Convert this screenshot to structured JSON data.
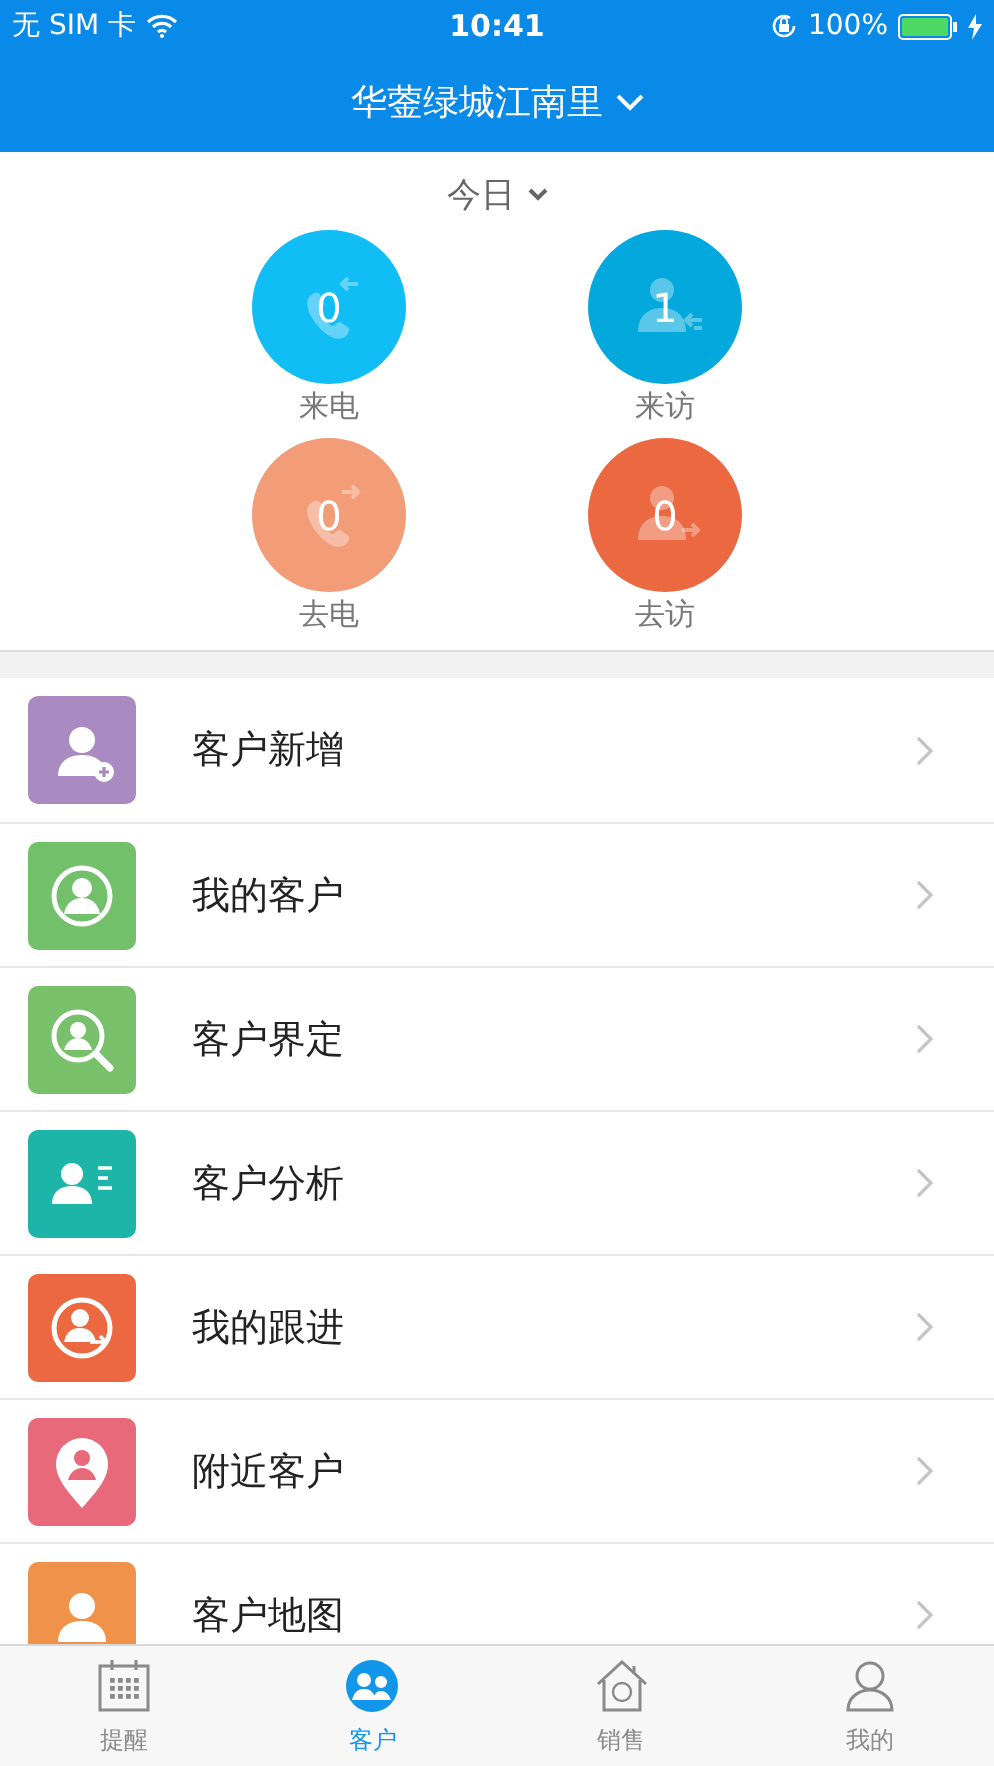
{
  "status_bar": {
    "carrier": "无 SIM 卡",
    "time": "10:41",
    "battery": "100%"
  },
  "header": {
    "title": "华蓥绿城江南里"
  },
  "period": {
    "label": "今日"
  },
  "stats": [
    {
      "kind": "phone-in",
      "count": "0",
      "label": "来电",
      "color": "#10bdf5"
    },
    {
      "kind": "visit-in",
      "count": "1",
      "label": "来访",
      "color": "#03a9dd"
    },
    {
      "kind": "phone-out",
      "count": "0",
      "label": "去电",
      "color": "#f39c78"
    },
    {
      "kind": "visit-out",
      "count": "0",
      "label": "去访",
      "color": "#ec6841"
    }
  ],
  "menu": [
    {
      "kind": "person-plus",
      "label": "客户新增",
      "color": "#a98bc1"
    },
    {
      "kind": "person-circle",
      "label": "我的客户",
      "color": "#73c06a"
    },
    {
      "kind": "person-search",
      "label": "客户界定",
      "color": "#79c06b"
    },
    {
      "kind": "person-list",
      "label": "客户分析",
      "color": "#1db5a8"
    },
    {
      "kind": "person-arrow",
      "label": "我的跟进",
      "color": "#ec6841"
    },
    {
      "kind": "person-pin",
      "label": "附近客户",
      "color": "#e8697a"
    },
    {
      "kind": "person",
      "label": "客户地图",
      "color": "#f0924a"
    }
  ],
  "tabs": [
    {
      "kind": "calendar",
      "label": "提醒",
      "selected": false
    },
    {
      "kind": "people",
      "label": "客户",
      "selected": true
    },
    {
      "kind": "house",
      "label": "销售",
      "selected": false
    },
    {
      "kind": "user",
      "label": "我的",
      "selected": false
    }
  ]
}
